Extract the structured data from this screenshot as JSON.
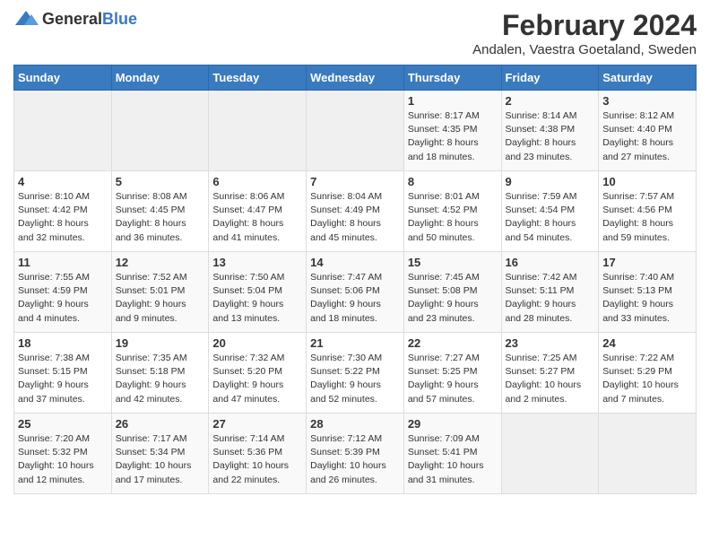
{
  "header": {
    "logo_general": "General",
    "logo_blue": "Blue",
    "main_title": "February 2024",
    "subtitle": "Andalen, Vaestra Goetaland, Sweden"
  },
  "weekdays": [
    "Sunday",
    "Monday",
    "Tuesday",
    "Wednesday",
    "Thursday",
    "Friday",
    "Saturday"
  ],
  "weeks": [
    [
      {
        "day": "",
        "info": ""
      },
      {
        "day": "",
        "info": ""
      },
      {
        "day": "",
        "info": ""
      },
      {
        "day": "",
        "info": ""
      },
      {
        "day": "1",
        "info": "Sunrise: 8:17 AM\nSunset: 4:35 PM\nDaylight: 8 hours\nand 18 minutes."
      },
      {
        "day": "2",
        "info": "Sunrise: 8:14 AM\nSunset: 4:38 PM\nDaylight: 8 hours\nand 23 minutes."
      },
      {
        "day": "3",
        "info": "Sunrise: 8:12 AM\nSunset: 4:40 PM\nDaylight: 8 hours\nand 27 minutes."
      }
    ],
    [
      {
        "day": "4",
        "info": "Sunrise: 8:10 AM\nSunset: 4:42 PM\nDaylight: 8 hours\nand 32 minutes."
      },
      {
        "day": "5",
        "info": "Sunrise: 8:08 AM\nSunset: 4:45 PM\nDaylight: 8 hours\nand 36 minutes."
      },
      {
        "day": "6",
        "info": "Sunrise: 8:06 AM\nSunset: 4:47 PM\nDaylight: 8 hours\nand 41 minutes."
      },
      {
        "day": "7",
        "info": "Sunrise: 8:04 AM\nSunset: 4:49 PM\nDaylight: 8 hours\nand 45 minutes."
      },
      {
        "day": "8",
        "info": "Sunrise: 8:01 AM\nSunset: 4:52 PM\nDaylight: 8 hours\nand 50 minutes."
      },
      {
        "day": "9",
        "info": "Sunrise: 7:59 AM\nSunset: 4:54 PM\nDaylight: 8 hours\nand 54 minutes."
      },
      {
        "day": "10",
        "info": "Sunrise: 7:57 AM\nSunset: 4:56 PM\nDaylight: 8 hours\nand 59 minutes."
      }
    ],
    [
      {
        "day": "11",
        "info": "Sunrise: 7:55 AM\nSunset: 4:59 PM\nDaylight: 9 hours\nand 4 minutes."
      },
      {
        "day": "12",
        "info": "Sunrise: 7:52 AM\nSunset: 5:01 PM\nDaylight: 9 hours\nand 9 minutes."
      },
      {
        "day": "13",
        "info": "Sunrise: 7:50 AM\nSunset: 5:04 PM\nDaylight: 9 hours\nand 13 minutes."
      },
      {
        "day": "14",
        "info": "Sunrise: 7:47 AM\nSunset: 5:06 PM\nDaylight: 9 hours\nand 18 minutes."
      },
      {
        "day": "15",
        "info": "Sunrise: 7:45 AM\nSunset: 5:08 PM\nDaylight: 9 hours\nand 23 minutes."
      },
      {
        "day": "16",
        "info": "Sunrise: 7:42 AM\nSunset: 5:11 PM\nDaylight: 9 hours\nand 28 minutes."
      },
      {
        "day": "17",
        "info": "Sunrise: 7:40 AM\nSunset: 5:13 PM\nDaylight: 9 hours\nand 33 minutes."
      }
    ],
    [
      {
        "day": "18",
        "info": "Sunrise: 7:38 AM\nSunset: 5:15 PM\nDaylight: 9 hours\nand 37 minutes."
      },
      {
        "day": "19",
        "info": "Sunrise: 7:35 AM\nSunset: 5:18 PM\nDaylight: 9 hours\nand 42 minutes."
      },
      {
        "day": "20",
        "info": "Sunrise: 7:32 AM\nSunset: 5:20 PM\nDaylight: 9 hours\nand 47 minutes."
      },
      {
        "day": "21",
        "info": "Sunrise: 7:30 AM\nSunset: 5:22 PM\nDaylight: 9 hours\nand 52 minutes."
      },
      {
        "day": "22",
        "info": "Sunrise: 7:27 AM\nSunset: 5:25 PM\nDaylight: 9 hours\nand 57 minutes."
      },
      {
        "day": "23",
        "info": "Sunrise: 7:25 AM\nSunset: 5:27 PM\nDaylight: 10 hours\nand 2 minutes."
      },
      {
        "day": "24",
        "info": "Sunrise: 7:22 AM\nSunset: 5:29 PM\nDaylight: 10 hours\nand 7 minutes."
      }
    ],
    [
      {
        "day": "25",
        "info": "Sunrise: 7:20 AM\nSunset: 5:32 PM\nDaylight: 10 hours\nand 12 minutes."
      },
      {
        "day": "26",
        "info": "Sunrise: 7:17 AM\nSunset: 5:34 PM\nDaylight: 10 hours\nand 17 minutes."
      },
      {
        "day": "27",
        "info": "Sunrise: 7:14 AM\nSunset: 5:36 PM\nDaylight: 10 hours\nand 22 minutes."
      },
      {
        "day": "28",
        "info": "Sunrise: 7:12 AM\nSunset: 5:39 PM\nDaylight: 10 hours\nand 26 minutes."
      },
      {
        "day": "29",
        "info": "Sunrise: 7:09 AM\nSunset: 5:41 PM\nDaylight: 10 hours\nand 31 minutes."
      },
      {
        "day": "",
        "info": ""
      },
      {
        "day": "",
        "info": ""
      }
    ]
  ]
}
